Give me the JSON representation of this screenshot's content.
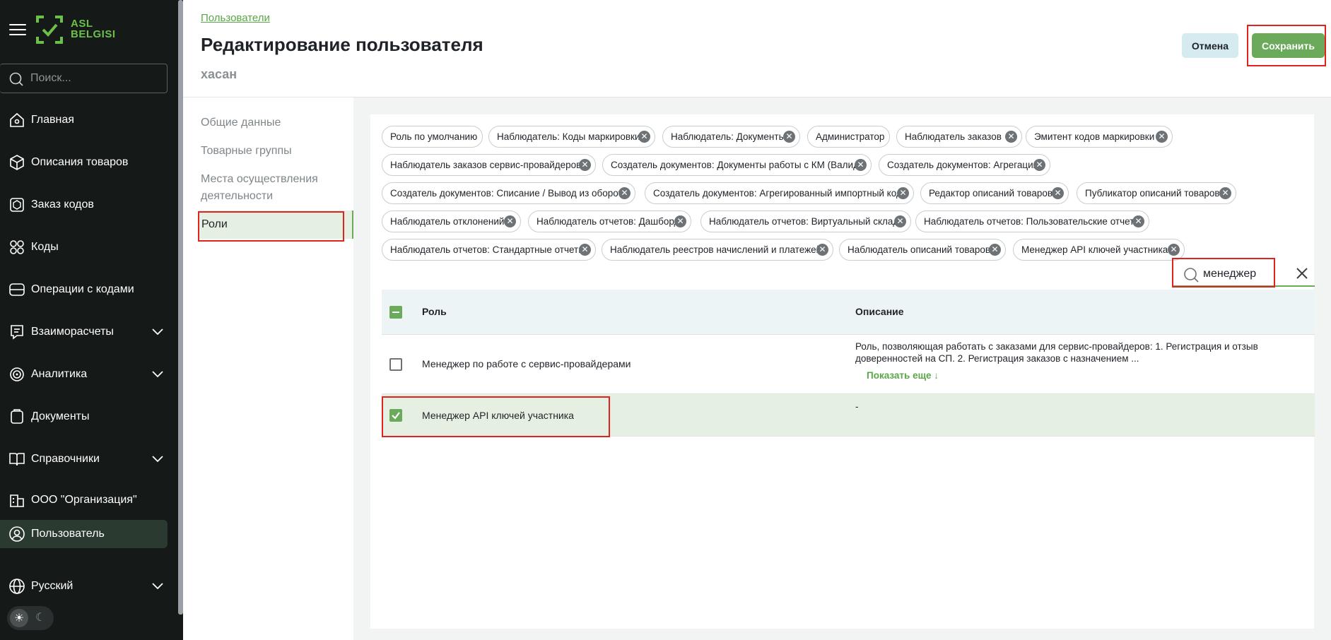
{
  "sidebar": {
    "logo_line1": "ASL",
    "logo_line2": "BELGISI",
    "search_placeholder": "Поиск...",
    "items": [
      {
        "label": "Главная",
        "icon": "home-icon"
      },
      {
        "label": "Описания товаров",
        "icon": "box-icon"
      },
      {
        "label": "Заказ кодов",
        "icon": "package-icon"
      },
      {
        "label": "Коды",
        "icon": "qr-code-icon"
      },
      {
        "label": "Операции с кодами",
        "icon": "operations-icon"
      },
      {
        "label": "Взаиморасчеты",
        "icon": "receipt-icon"
      },
      {
        "label": "Аналитика",
        "icon": "analytics-icon"
      },
      {
        "label": "Документы",
        "icon": "documents-icon"
      },
      {
        "label": "Справочники",
        "icon": "book-icon"
      },
      {
        "label": "ООО \"Организация\"",
        "icon": "building-icon"
      },
      {
        "label": "Пользователь",
        "icon": "user-icon"
      },
      {
        "label": "Русский",
        "icon": "globe-icon"
      }
    ]
  },
  "header": {
    "breadcrumb": "Пользователи",
    "title": "Редактирование пользователя",
    "subtitle": "хасан",
    "cancel_label": "Отмена",
    "save_label": "Сохранить"
  },
  "tabs": [
    {
      "label": "Общие данные"
    },
    {
      "label": "Товарные группы"
    },
    {
      "label": "Места осуществления"
    },
    {
      "label": "деятельности"
    },
    {
      "label": "Роли"
    }
  ],
  "chips": [
    "Роль по умолчанию",
    "Наблюдатель: Коды маркировки",
    "Наблюдатель: Документы",
    "Администратор",
    "Наблюдатель заказов",
    "Эмитент кодов маркировки",
    "Наблюдатель заказов сервис-провайдеров",
    "Создатель документов: Документы работы с КМ (Валид...",
    "Создатель документов: Агрегация",
    "Создатель документов: Списание / Вывод из оборота",
    "Создатель документов: Агрегированный импортный код",
    "Редактор описаний товаров",
    "Публикатор описаний товаров",
    "Наблюдатель отклонений",
    "Наблюдатель отчетов: Дашборд",
    "Наблюдатель отчетов: Виртуальный склад",
    "Наблюдатель отчетов: Пользовательские отчеты",
    "Наблюдатель отчетов: Стандартные отчеты",
    "Наблюдатель реестров начислений и платежей",
    "Наблюдатель описаний товаров",
    "Менеджер API ключей участника"
  ],
  "role_search": {
    "value": "менеджер"
  },
  "table": {
    "col_role": "Роль",
    "col_desc": "Описание",
    "rows": [
      {
        "role": "Менеджер по работе с сервис-провайдерами",
        "desc_line1": "Роль, позволяющая работать с заказами для сервис-провайдеров: 1. Регистрация и отзыв",
        "desc_line2": "доверенностей на СП. 2. Регистрация заказов с назначением ...",
        "show_more": "Показать еще ↓",
        "checked": false
      },
      {
        "role": "Менеджер API ключей участника",
        "desc_line1": "-",
        "checked": true
      }
    ]
  },
  "colors": {
    "accent": "#6aaa5a",
    "sidebar_bg": "#151a19",
    "highlight": "#e0231c"
  }
}
